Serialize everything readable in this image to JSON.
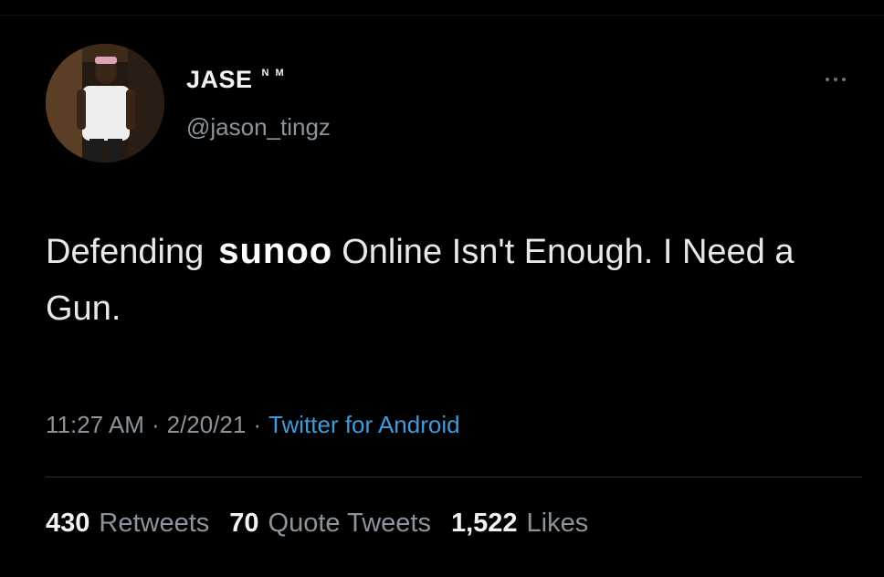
{
  "user": {
    "display_name": "JASE",
    "name_suffix": "N M",
    "handle": "@jason_tingz"
  },
  "tweet": {
    "text_before": "Defending",
    "text_highlight": "sunoo",
    "text_after": "Online Isn't Enough. I Need a Gun."
  },
  "meta": {
    "time": "11:27 AM",
    "separator1": "·",
    "date": "2/20/21",
    "separator2": "·",
    "source": "Twitter for Android"
  },
  "stats": {
    "retweets_count": "430",
    "retweets_label": "Retweets",
    "quotes_count": "70",
    "quotes_label": "Quote Tweets",
    "likes_count": "1,522",
    "likes_label": "Likes"
  },
  "icons": {
    "more": "more-horizontal-icon"
  },
  "colors": {
    "background": "#000000",
    "link": "#3f9bdc",
    "muted": "#8b949c"
  }
}
